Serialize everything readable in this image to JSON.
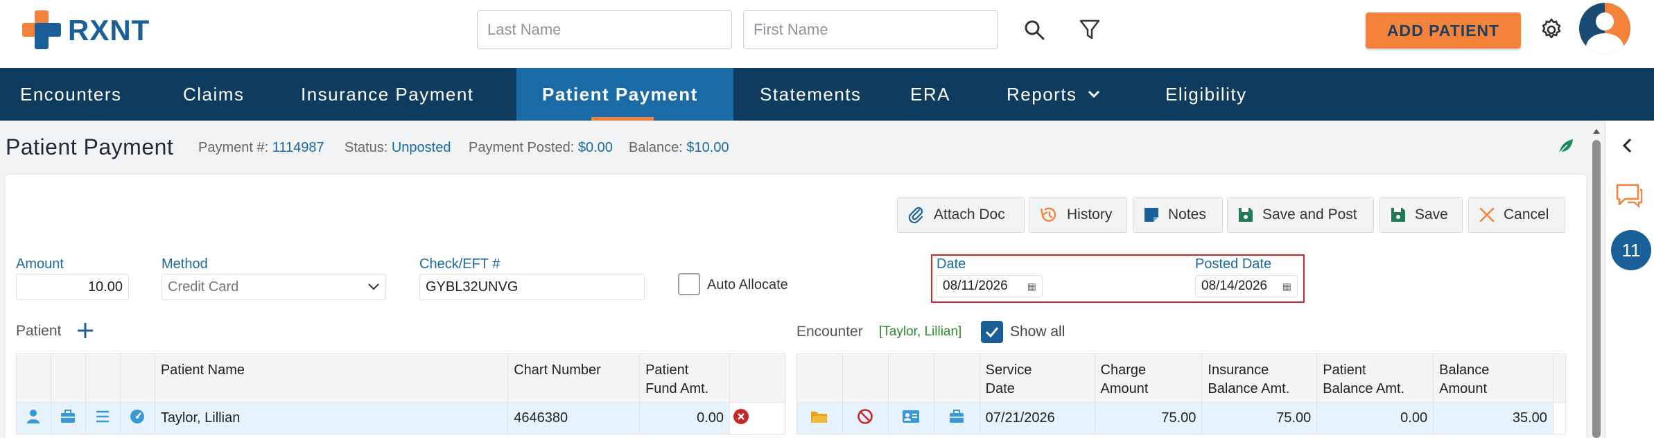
{
  "app": {
    "logo_text": "RXNT"
  },
  "search": {
    "last_name_placeholder": "Last Name",
    "first_name_placeholder": "First Name"
  },
  "header": {
    "add_patient_label": "ADD PATIENT"
  },
  "nav": {
    "items": [
      "Encounters",
      "Claims",
      "Insurance Payment",
      "Patient Payment",
      "Statements",
      "ERA",
      "Reports",
      "Eligibility"
    ],
    "active": "Patient Payment"
  },
  "page": {
    "title": "Patient Payment",
    "payment_no_label": "Payment #:",
    "payment_no": "1114987",
    "status_label": "Status:",
    "status": "Unposted",
    "posted_label": "Payment Posted:",
    "posted": "$0.00",
    "balance_label": "Balance:",
    "balance": "$10.00"
  },
  "actions": {
    "attach": "Attach Doc",
    "history": "History",
    "notes": "Notes",
    "save_post": "Save and Post",
    "save": "Save",
    "cancel": "Cancel"
  },
  "form": {
    "amount_label": "Amount",
    "amount": "10.00",
    "method_label": "Method",
    "method": "Credit Card",
    "check_label": "Check/EFT #",
    "check": "GYBL32UNVG",
    "auto_allocate": "Auto Allocate",
    "date_label": "Date",
    "date": "08/11/2026",
    "posted_date_label": "Posted Date",
    "posted_date": "08/14/2026"
  },
  "patient_table": {
    "section_label": "Patient",
    "headers": {
      "name": "Patient Name",
      "chart": "Chart Number",
      "fund_1": "Patient",
      "fund_2": "Fund Amt."
    },
    "rows": [
      {
        "name": "Taylor, Lillian",
        "chart": "4646380",
        "fund": "0.00"
      }
    ]
  },
  "encounter_table": {
    "section_label": "Encounter",
    "patient_tag": "[Taylor, Lillian]",
    "show_all": "Show all",
    "headers": {
      "service_1": "Service",
      "service_2": "Date",
      "charge_1": "Charge",
      "charge_2": "Amount",
      "ins_1": "Insurance",
      "ins_2": "Balance Amt.",
      "pat_1": "Patient",
      "pat_2": "Balance Amt.",
      "bal_1": "Balance",
      "bal_2": "Amount"
    },
    "rows": [
      {
        "service_date": "07/21/2026",
        "charge": "75.00",
        "ins_balance": "75.00",
        "pat_balance": "0.00",
        "balance": "35.00"
      }
    ]
  },
  "sidebar": {
    "badge_count": "11"
  },
  "colors": {
    "navy": "#0e3b5e",
    "active_nav": "#1a6aa6",
    "accent_orange": "#f5823a",
    "link_blue": "#1a6aa6",
    "highlight_red": "#d7262b"
  }
}
